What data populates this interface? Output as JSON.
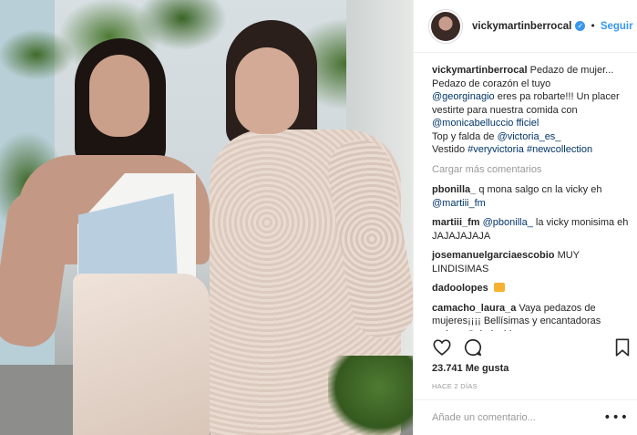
{
  "post": {
    "username": "vickymartinberrocal",
    "follow_label": "Seguir",
    "caption": {
      "user": "vickymartinberrocal",
      "parts": [
        {
          "text": "Pedazo de mujer... Pedazo de corazón el tuyo ",
          "type": "text"
        },
        {
          "text": "@georginagio",
          "type": "mention"
        },
        {
          "text": " eres pa robarte!!! Un placer vestirte para nuestra comida con ",
          "type": "text"
        },
        {
          "text": "@monicabelluccio fficiel",
          "type": "mention"
        },
        {
          "text": " Top y falda de ",
          "type": "text"
        },
        {
          "text": "@victoria_es_",
          "type": "mention"
        },
        {
          "text": " Vestido ",
          "type": "text"
        },
        {
          "text": "#veryvictoria",
          "type": "tag"
        },
        {
          "text": " ",
          "type": "text"
        },
        {
          "text": "#newcollection",
          "type": "tag"
        }
      ]
    },
    "load_more": "Cargar más comentarios",
    "comments": [
      {
        "user": "pbonilla_",
        "text": "q mona salgo cn la vicky eh",
        "mention": "@martiii_fm"
      },
      {
        "user": "martiii_fm",
        "mention": "@pbonilla_",
        "text": "la vicky monisima eh JAJAJAJAJA"
      },
      {
        "user": "josemanuelgarciaescobio",
        "text": "MUY LINDISIMAS"
      },
      {
        "user": "dadoolopes",
        "text": ""
      },
      {
        "user": "camacho_laura_a",
        "text": "Vaya pedazos de mujeres¡¡¡¡ Bellísimas y encantadoras ambas. Salud, chicas¡¡¡"
      }
    ],
    "likes": "23.741 Me gusta",
    "time": "HACE 2 DÍAS",
    "add_comment_placeholder": "Añade un comentario...",
    "more": "•••"
  },
  "icons": {
    "like": "heart-icon",
    "comment": "comment-bubble-icon",
    "save": "bookmark-icon",
    "verified": "verified-badge-icon"
  },
  "colors": {
    "link": "#003569",
    "follow": "#3897f0",
    "muted": "#999999"
  }
}
